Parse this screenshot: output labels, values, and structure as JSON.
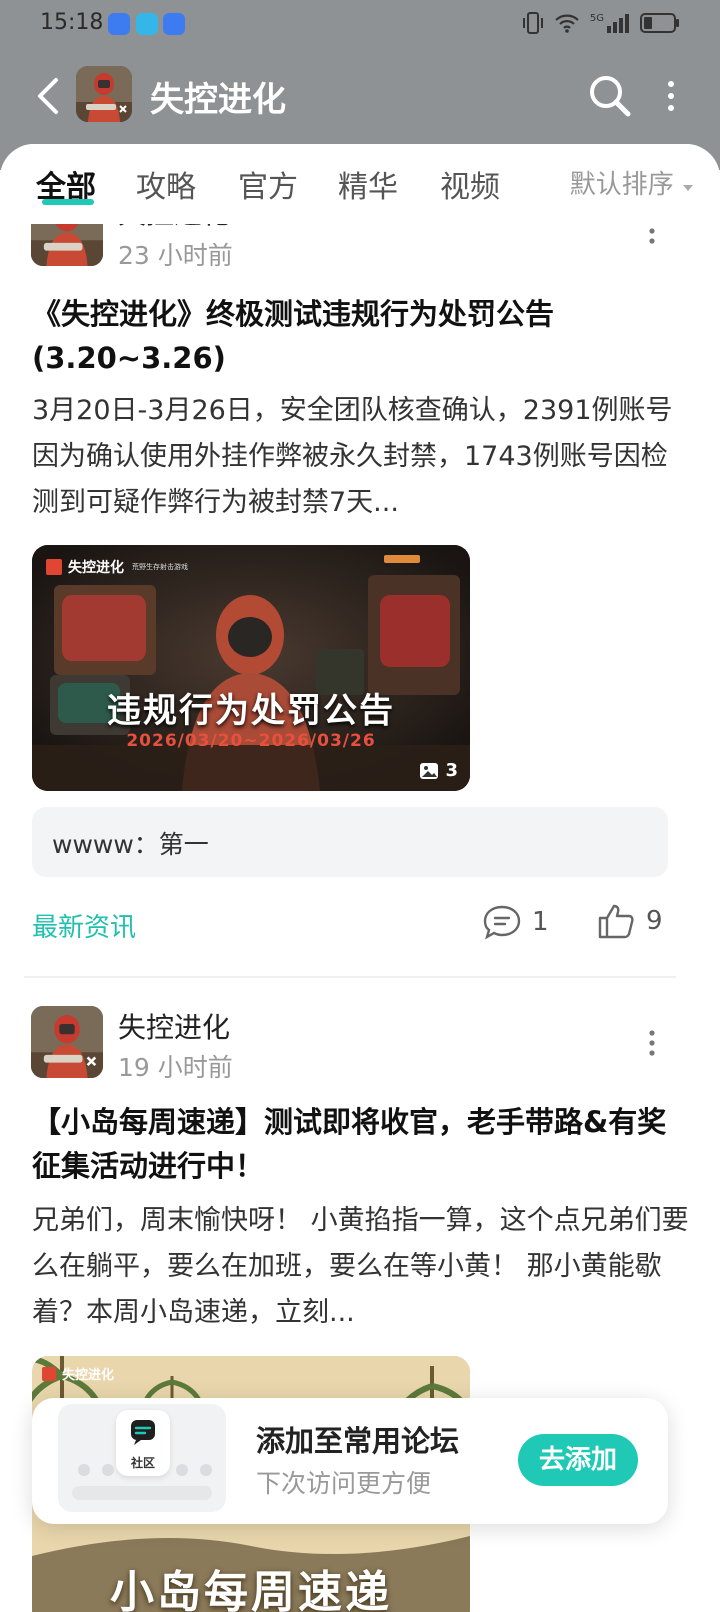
{
  "status_bar": {
    "time": "15:18",
    "network": "5G"
  },
  "app_bar": {
    "title": "失控进化"
  },
  "tabs": [
    {
      "label": "全部"
    },
    {
      "label": "攻略"
    },
    {
      "label": "官方"
    },
    {
      "label": "精华"
    },
    {
      "label": "视频"
    }
  ],
  "sort_label": "默认排序",
  "posts": [
    {
      "author": "失控进化",
      "time": "23 小时前",
      "title": "《失控进化》终极测试违规行为处罚公告 (3.20~3.26)",
      "body": "3月20日-3月26日，安全团队核查确认，2391例账号因为确认使用外挂作弊被永久封禁，1743例账号因检测到可疑作弊行为被封禁7天...",
      "image": {
        "brand": "失控进化",
        "brand_sub": "荒野生存射击游戏",
        "headline": "违规行为处罚公告",
        "dates": "2026/03/20~2026/03/26",
        "count": "3"
      },
      "comment_preview": "wwww：第一",
      "tag": "最新资讯",
      "comments": "1",
      "likes": "9"
    },
    {
      "author": "失控进化",
      "time": "19 小时前",
      "title": "【小岛每周速递】测试即将收官，老手带路&有奖征集活动进行中！",
      "body": "兄弟们，周末愉快呀！ 小黄掐指一算，这个点兄弟们要么在躺平，要么在加班，要么在等小黄！ 那小黄能歇着？本周小岛速递，立刻...",
      "image": {
        "brand": "失控进化",
        "headline": "小岛每周速递"
      }
    }
  ],
  "add_card": {
    "icon_label": "社区",
    "title": "添加至常用论坛",
    "subtitle": "下次访问更方便",
    "button": "去添加"
  },
  "colors": {
    "accent": "#20c9b5",
    "header_bg": "#8e9294"
  }
}
